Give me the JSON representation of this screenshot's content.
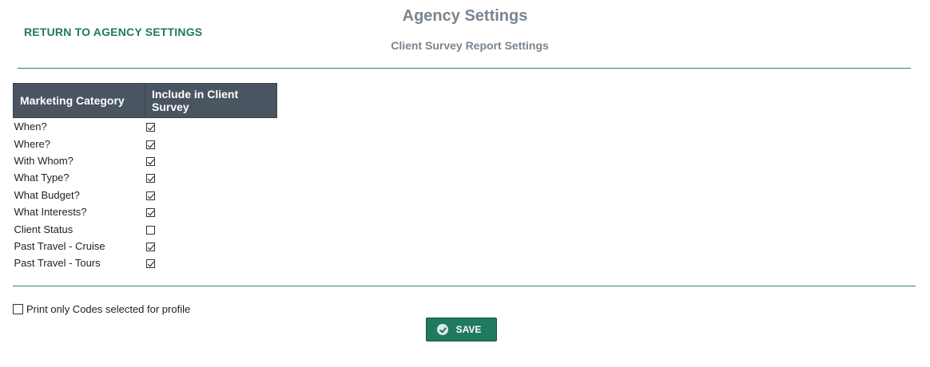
{
  "header": {
    "return_link": "RETURN TO AGENCY SETTINGS",
    "title": "Agency Settings",
    "subtitle": "Client Survey Report Settings"
  },
  "table": {
    "columns": [
      "Marketing Category",
      "Include in Client Survey"
    ],
    "rows": [
      {
        "label": "When?",
        "checked": true
      },
      {
        "label": "Where?",
        "checked": true
      },
      {
        "label": "With Whom?",
        "checked": true
      },
      {
        "label": "What Type?",
        "checked": true
      },
      {
        "label": "What Budget?",
        "checked": true
      },
      {
        "label": "What Interests?",
        "checked": true
      },
      {
        "label": "Client Status",
        "checked": false
      },
      {
        "label": "Past Travel - Cruise",
        "checked": true
      },
      {
        "label": "Past Travel - Tours",
        "checked": true
      }
    ]
  },
  "print_option": {
    "label": "Print only Codes selected for profile",
    "checked": false
  },
  "save_button": {
    "label": "SAVE",
    "icon": "check-circle-icon"
  },
  "colors": {
    "accent": "#1f7a60",
    "header_bg": "#4a5562",
    "title": "#7a858f"
  }
}
